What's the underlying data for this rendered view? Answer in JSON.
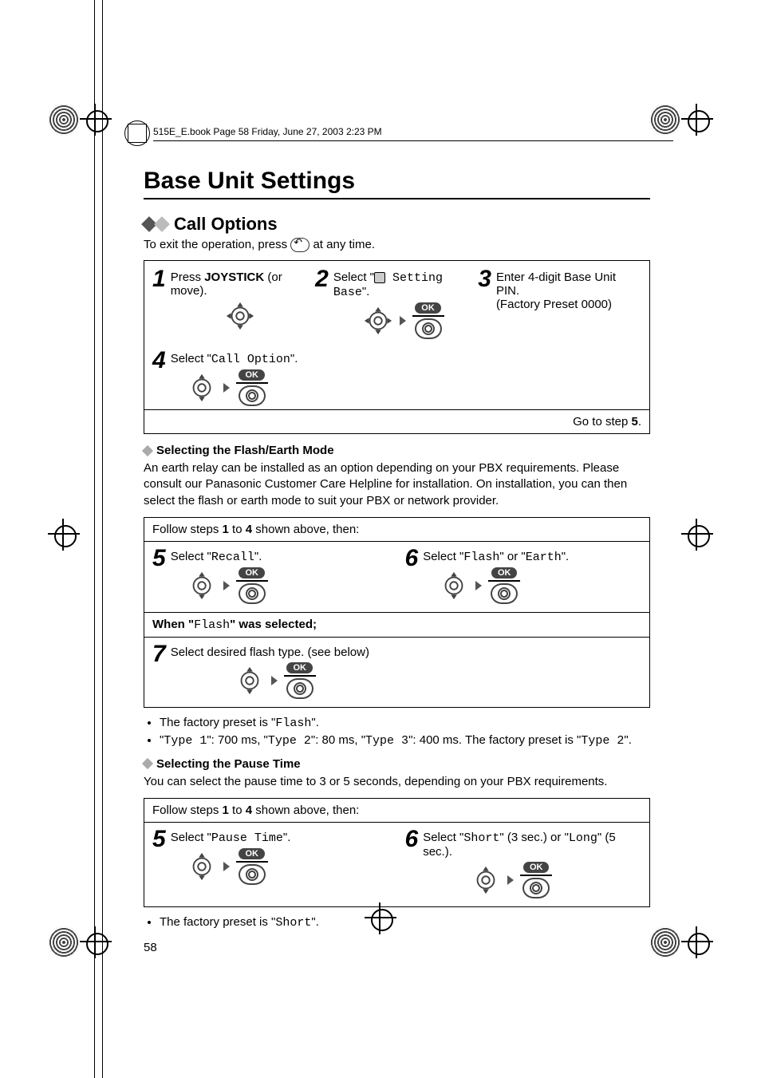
{
  "doc_tag": "515E_E.book  Page 58  Friday, June 27, 2003  2:23 PM",
  "h1": "Base Unit Settings",
  "h2": "Call Options",
  "exit_prefix": "To exit the operation, press ",
  "exit_suffix": " at any time.",
  "top_steps": {
    "s1": {
      "num": "1",
      "pre": "Press ",
      "bold": "JOYSTICK",
      "post": " (or move)."
    },
    "s2": {
      "num": "2",
      "pre": "Select \"",
      "mono": " Setting Base",
      "post": "\"."
    },
    "s3": {
      "num": "3",
      "l1": "Enter 4-digit Base Unit PIN.",
      "l2": "(Factory Preset 0000)"
    },
    "s4": {
      "num": "4",
      "pre": "Select \"",
      "mono": "Call Option",
      "post": "\"."
    }
  },
  "go_to": {
    "pre": "Go to step ",
    "bold": "5",
    "post": "."
  },
  "flash_head": "Selecting the Flash/Earth Mode",
  "flash_body": "An earth relay can be installed as an option depending on your PBX requirements. Please consult our Panasonic Customer Care Helpline for installation. On installation, you can then select the flash or earth mode to suit your PBX or network provider.",
  "follow": {
    "pre": "Follow steps ",
    "b1": "1",
    "mid": " to ",
    "b2": "4",
    "post": " shown above, then:"
  },
  "flash_steps": {
    "s5": {
      "num": "5",
      "pre": "Select \"",
      "mono": "Recall",
      "post": "\"."
    },
    "s6": {
      "num": "6",
      "pre": "Select \"",
      "mono1": "Flash",
      "mid": "\" or \"",
      "mono2": "Earth",
      "post": "\"."
    }
  },
  "when_bar": {
    "pre": "When ",
    "q1": "\"",
    "mono": "Flash",
    "q2": "\"",
    "post": " was selected;"
  },
  "s7": {
    "num": "7",
    "text": "Select desired flash type. (see below)"
  },
  "flash_bullets": {
    "b1": {
      "pre": "The factory preset is \"",
      "mono": "Flash",
      "post": "\"."
    },
    "b2": {
      "q": "\"",
      "t1": "Type 1",
      "v1": "\": 700 ms, \"",
      "t2": "Type 2",
      "v2": "\": 80 ms, \"",
      "t3": "Type 3",
      "v3": "\": 400 ms. The factory preset is \"",
      "t4": "Type 2",
      "end": "\"."
    }
  },
  "pause_head": "Selecting the Pause Time",
  "pause_body": "You can select the pause time to 3 or 5 seconds, depending on your PBX requirements.",
  "pause_steps": {
    "s5": {
      "num": "5",
      "pre": "Select \"",
      "mono": "Pause Time",
      "post": "\"."
    },
    "s6": {
      "num": "6",
      "pre": "Select \"",
      "m1": "Short",
      "mid1": "\" (3 sec.) or \"",
      "m2": "Long",
      "mid2": "\" (5 sec.)."
    }
  },
  "pause_bullet": {
    "pre": "The factory preset is \"",
    "mono": "Short",
    "post": "\"."
  },
  "ok_label": "OK",
  "page_number": "58"
}
